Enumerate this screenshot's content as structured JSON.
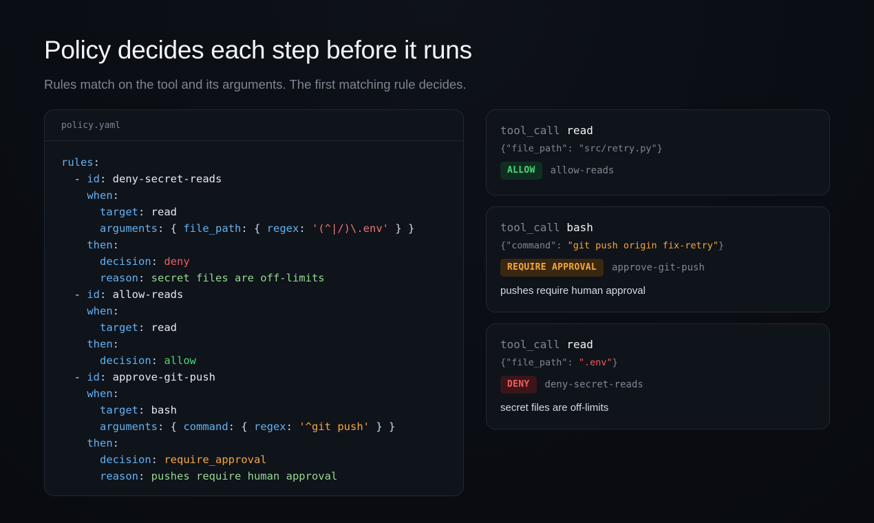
{
  "header": {
    "title": "Policy decides each step before it runs",
    "subtitle": "Rules match on the tool and its arguments. The first matching rule decides."
  },
  "code": {
    "filename": "policy.yaml",
    "rules_key": "rules",
    "rules": [
      {
        "id": "deny-secret-reads",
        "target": "read",
        "arguments": {
          "key": "file_path",
          "regex": "'(^|/)\\.env'"
        },
        "decision": "deny",
        "reason": "secret files are off-limits"
      },
      {
        "id": "allow-reads",
        "target": "read",
        "decision": "allow"
      },
      {
        "id": "approve-git-push",
        "target": "bash",
        "arguments": {
          "key": "command",
          "regex": "'^git push'"
        },
        "decision": "require_approval",
        "reason": "pushes require human approval"
      }
    ]
  },
  "tool_calls": [
    {
      "label": "tool_call",
      "tool": "read",
      "args_key": "\"file_path\"",
      "args_value": "\"src/retry.py\"",
      "badge": "ALLOW",
      "rule": "allow-reads"
    },
    {
      "label": "tool_call",
      "tool": "bash",
      "args_key": "\"command\"",
      "args_value": "\"git push origin fix-retry\"",
      "badge": "REQUIRE APPROVAL",
      "rule": "approve-git-push",
      "reason": "pushes require human approval"
    },
    {
      "label": "tool_call",
      "tool": "read",
      "args_key": "\"file_path\"",
      "args_value": "\".env\"",
      "badge": "DENY",
      "rule": "deny-secret-reads",
      "reason": "secret files are off-limits"
    }
  ],
  "colors": {
    "allow": "#4ad975",
    "approval": "#f5a836",
    "deny": "#f25d5d",
    "key": "#5fb4f5"
  }
}
